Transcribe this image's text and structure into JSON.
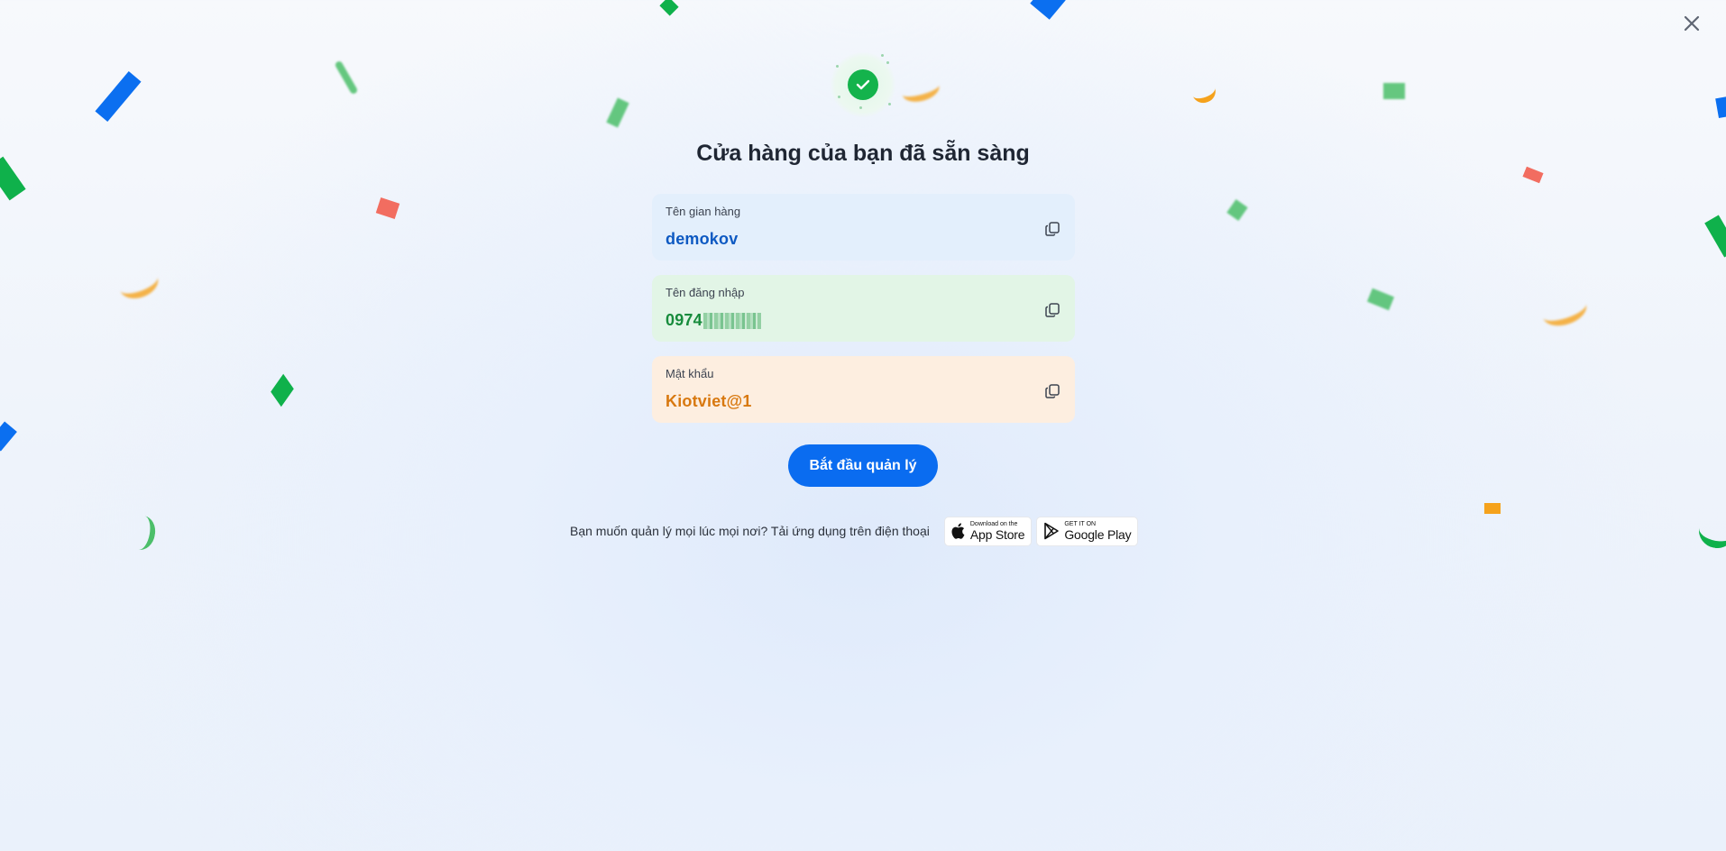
{
  "header": {
    "close_icon": "close-icon"
  },
  "success": {
    "icon": "check-circle-icon",
    "title": "Cửa hàng của bạn đã sẵn sàng"
  },
  "cards": {
    "store": {
      "label": "Tên gian hàng",
      "value": "demokov",
      "copy_icon": "copy-icon"
    },
    "login": {
      "label": "Tên đăng nhập",
      "value_visible": "0974",
      "value_obscured": true,
      "copy_icon": "copy-icon"
    },
    "password": {
      "label": "Mật khẩu",
      "value": "Kiotviet@1",
      "copy_icon": "copy-icon"
    }
  },
  "primary_action": {
    "label": "Bắt đầu quản lý"
  },
  "download": {
    "text": "Bạn muốn quản lý mọi lúc mọi nơi? Tải ứng dụng trên điện thoại",
    "app_store": {
      "small": "Download on the",
      "big": "App Store",
      "icon": "apple-icon"
    },
    "google_play": {
      "small": "GET IT ON",
      "big": "Google Play",
      "icon": "google-play-icon"
    }
  },
  "colors": {
    "primary": "#0a6cf0",
    "success": "#14b34c",
    "store_card_bg": "#e3effc",
    "login_card_bg": "#e2f5e6",
    "password_card_bg": "#fdeee0",
    "store_value": "#0d59c2",
    "login_value": "#178b3c",
    "password_value": "#d8780f"
  }
}
